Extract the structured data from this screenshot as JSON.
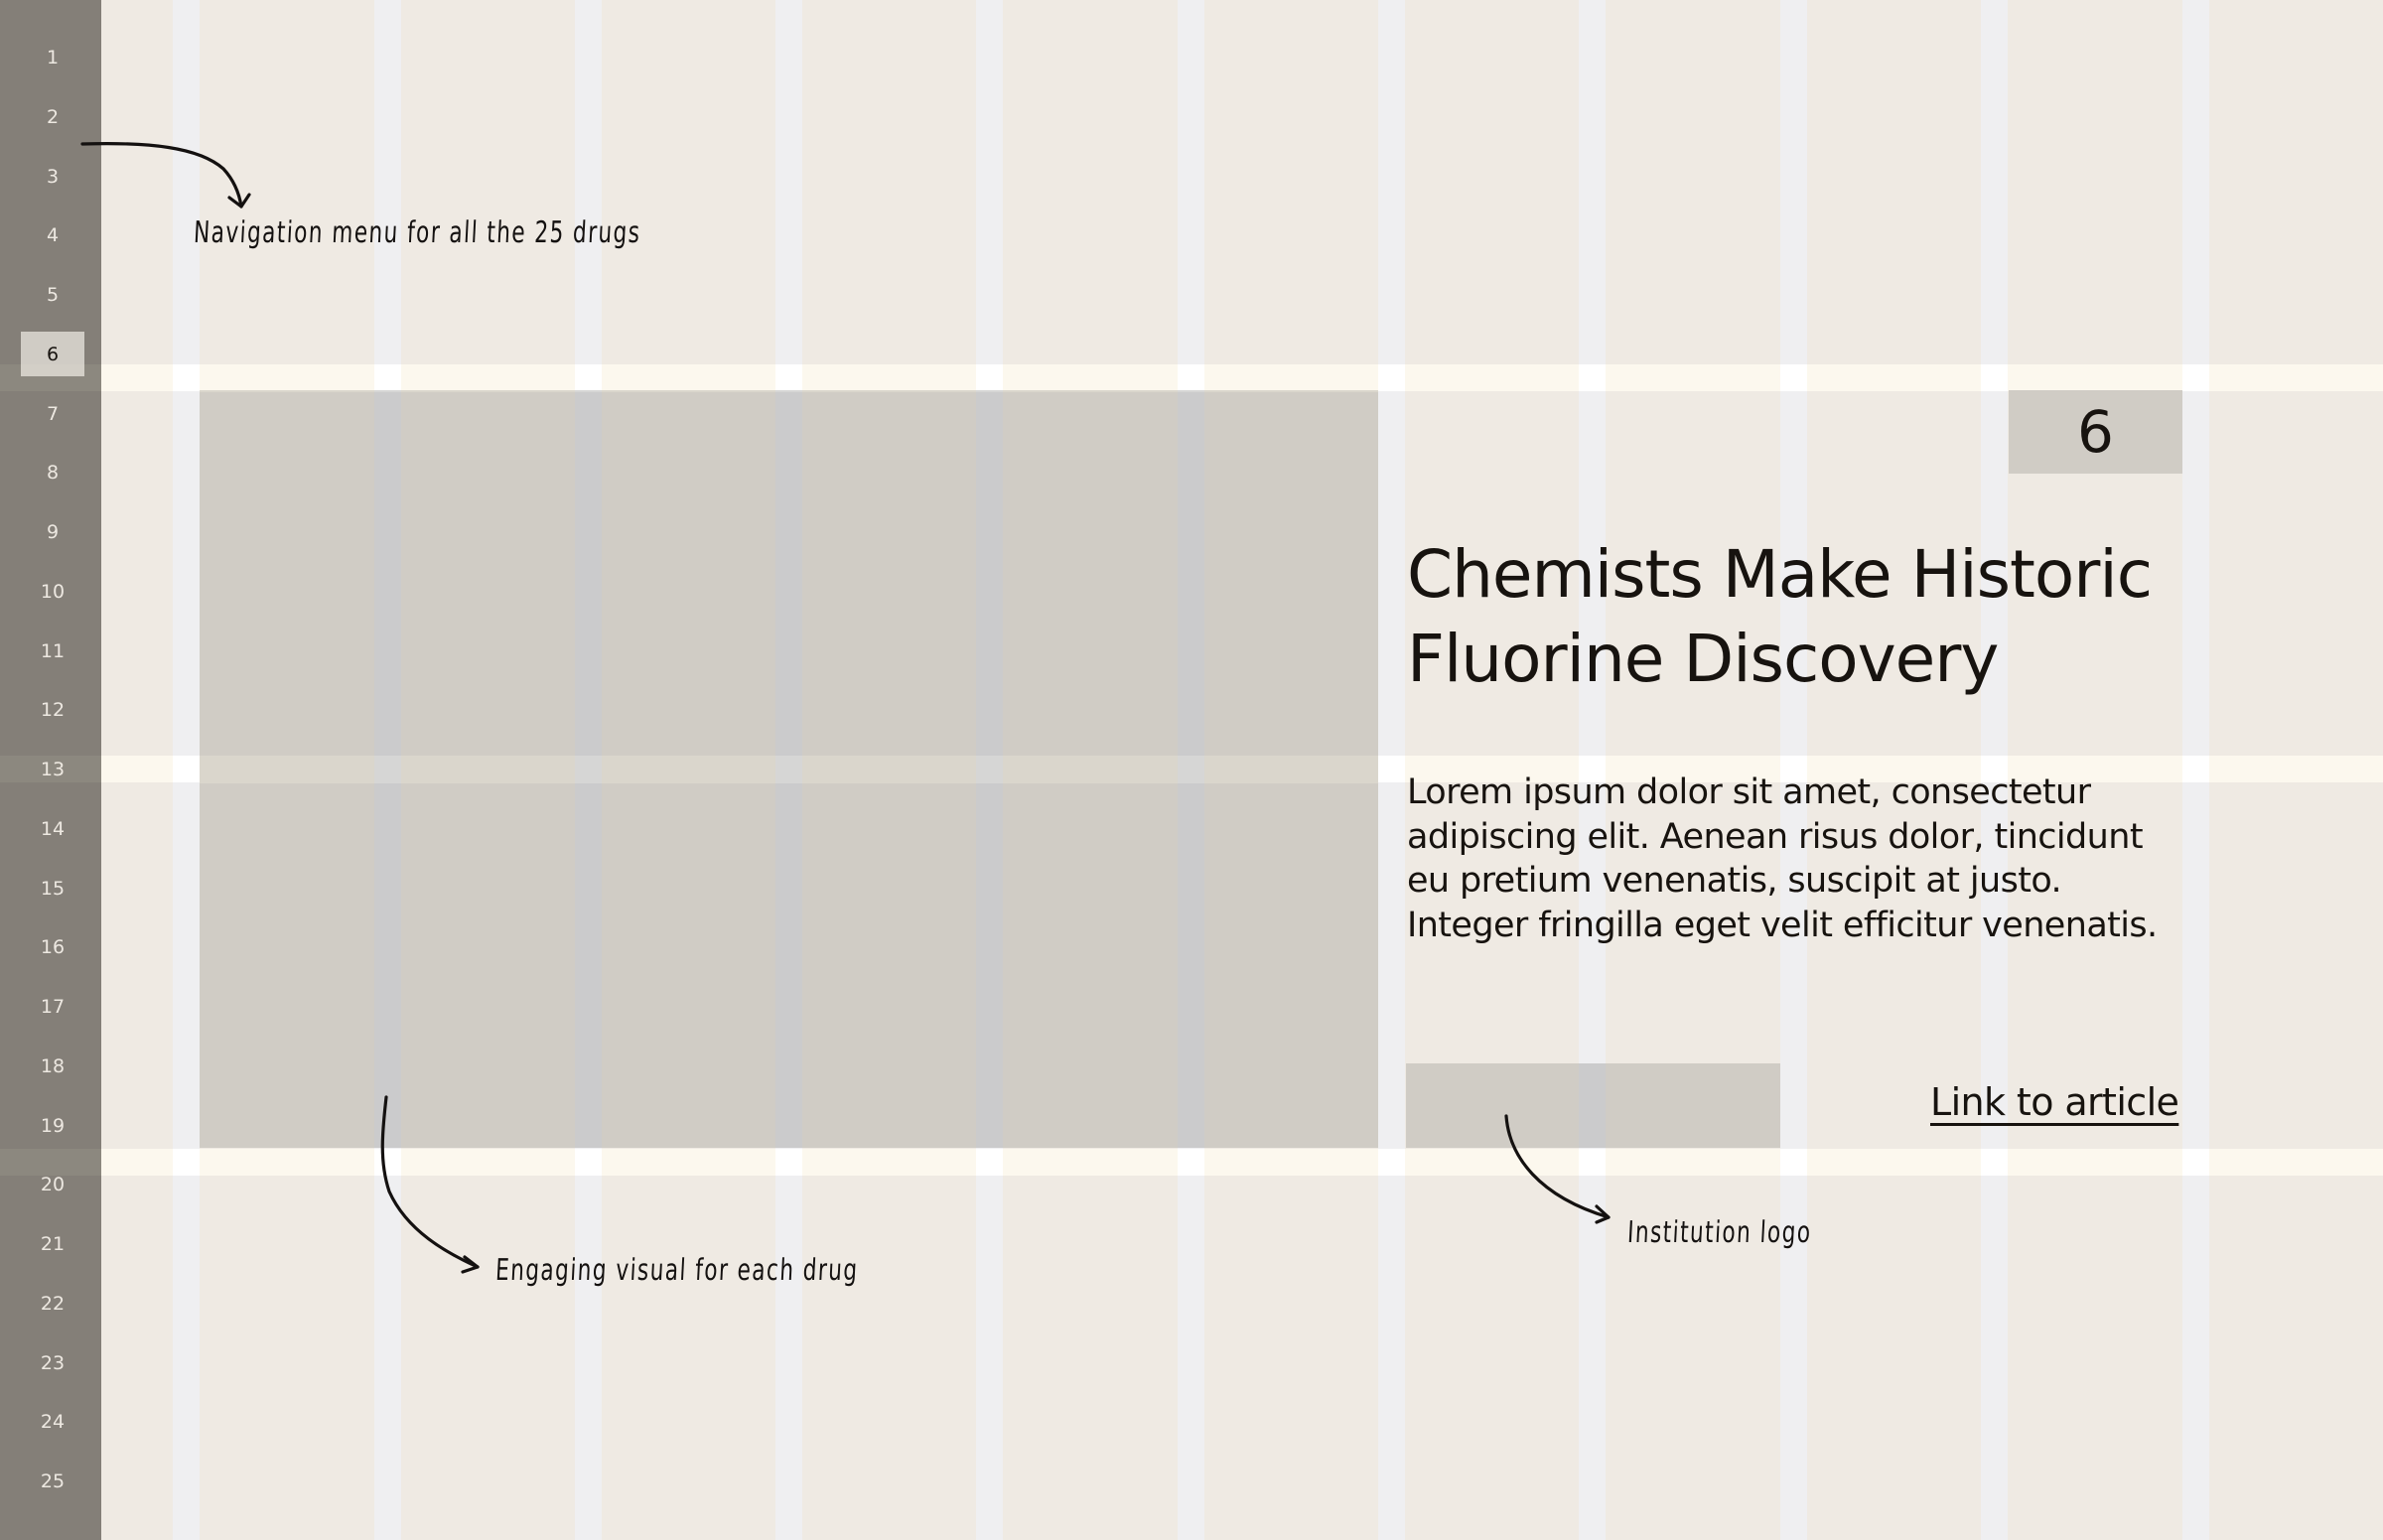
{
  "grid": {
    "colors": {
      "background": "#EFEAE3",
      "column_gutter": "#EFEFF1",
      "row_band": "#FCF8EE",
      "placeholder": "#D0CCC5",
      "sidebar": "#847F78",
      "text": "#17130F"
    }
  },
  "sidebar": {
    "active_index": 5,
    "items": [
      {
        "label": "1"
      },
      {
        "label": "2"
      },
      {
        "label": "3"
      },
      {
        "label": "4"
      },
      {
        "label": "5"
      },
      {
        "label": "6"
      },
      {
        "label": "7"
      },
      {
        "label": "8"
      },
      {
        "label": "9"
      },
      {
        "label": "10"
      },
      {
        "label": "11"
      },
      {
        "label": "12"
      },
      {
        "label": "13"
      },
      {
        "label": "14"
      },
      {
        "label": "15"
      },
      {
        "label": "16"
      },
      {
        "label": "17"
      },
      {
        "label": "18"
      },
      {
        "label": "19"
      },
      {
        "label": "20"
      },
      {
        "label": "21"
      },
      {
        "label": "22"
      },
      {
        "label": "23"
      },
      {
        "label": "24"
      },
      {
        "label": "25"
      }
    ]
  },
  "article": {
    "number": "6",
    "title_line1": "Chemists Make Historic",
    "title_line2": "Fluorine Discovery",
    "body": "Lorem ipsum dolor sit amet, consectetur adipiscing elit. Aenean risus dolor, tincidunt eu pretium venenatis, suscipit at justo. Integer fringilla eget velit efficitur venenatis.",
    "link_label": "Link to article"
  },
  "annotations": {
    "navigation": "Navigation menu for all the 25 drugs",
    "visual": "Engaging visual for each drug",
    "logo": "Institution logo"
  }
}
